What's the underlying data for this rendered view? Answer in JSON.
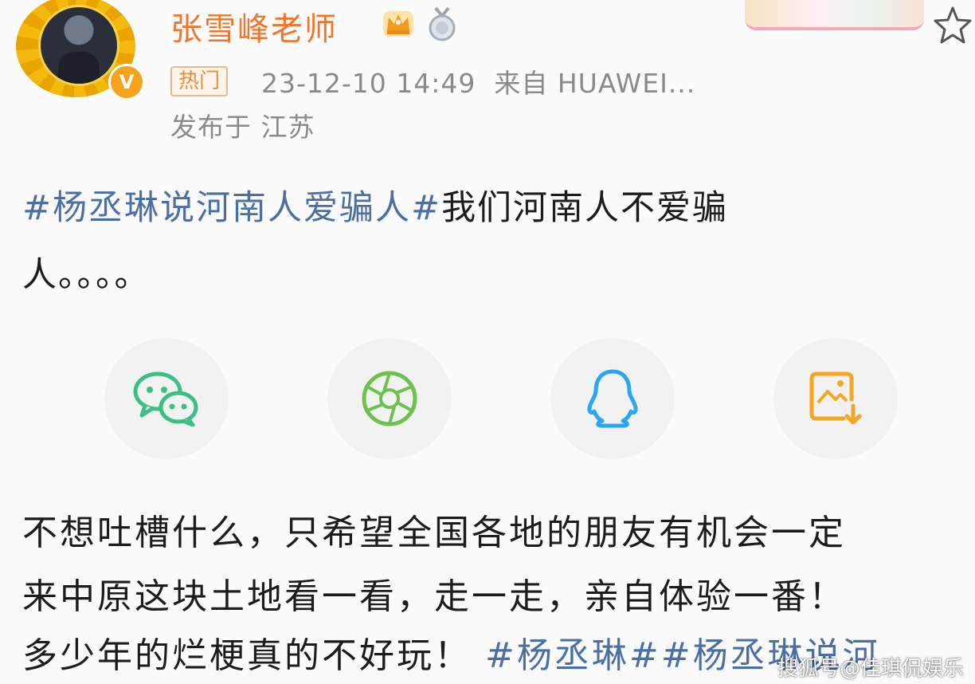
{
  "post": {
    "author": "张雪峰老师",
    "hot_tag": "热门",
    "timestamp": "23-12-10 14:49",
    "source": "来自 HUAWEI...",
    "location": "发布于 江苏",
    "hashtag": "#杨丞琳说河南人爱骗人#",
    "text_line1": "我们河南人不爱骗",
    "text_line2": "人。。。。"
  },
  "share": [
    {
      "icon": "wechat-icon",
      "color": "#3bbf86"
    },
    {
      "icon": "moments-icon",
      "color": "#6cc24a"
    },
    {
      "icon": "qq-icon",
      "color": "#2aa7f2"
    },
    {
      "icon": "save-image-icon",
      "color": "#f5a623"
    }
  ],
  "comment": {
    "line1": "不想吐槽什么，只希望全国各地的朋友有机会一定",
    "line2": "来中原这块土地看一看，走一走，亲自体验一番！",
    "line3_text": "多少年的烂梗真的不好玩！",
    "line3_hashtag": "#杨丞琳##杨丞琳说河"
  },
  "watermark": "搜狐号@佳琪侃娱乐",
  "colors": {
    "username": "#f0762b",
    "hashtag": "#4a6fa5",
    "meta": "#8a8a8a"
  }
}
